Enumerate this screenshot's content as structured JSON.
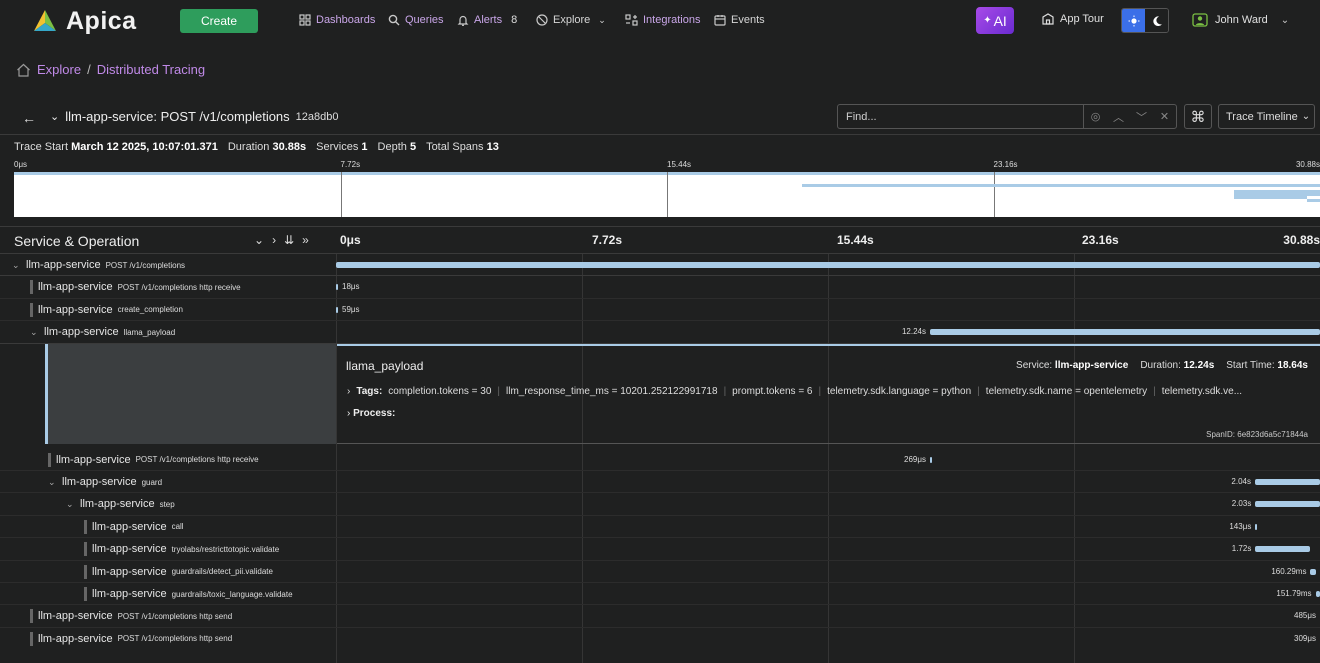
{
  "nav": {
    "brand": "Apica",
    "create": "Create",
    "items": [
      "Dashboards",
      "Queries",
      "Alerts",
      "Explore",
      "Integrations",
      "Events"
    ],
    "alerts_count": "8",
    "ai": "AI",
    "app_tour": "App Tour",
    "user": "John Ward"
  },
  "breadcrumb": {
    "items": [
      "Explore",
      "Distributed Tracing"
    ],
    "sep": "/"
  },
  "trace": {
    "title": "llm-app-service: POST /v1/completions",
    "id": "12a8db0",
    "find_placeholder": "Find...",
    "view": "Trace Timeline",
    "meta": {
      "start_label": "Trace Start",
      "start": "March 12 2025, 10:07:01.371",
      "duration_label": "Duration",
      "duration": "30.88s",
      "services_label": "Services",
      "services": "1",
      "depth_label": "Depth",
      "depth": "5",
      "spans_label": "Total Spans",
      "spans": "13"
    }
  },
  "timeline": {
    "ticks": [
      "0μs",
      "7.72s",
      "15.44s",
      "23.16s",
      "30.88s"
    ],
    "header_label": "Service & Operation"
  },
  "spans": [
    {
      "service": "llm-app-service",
      "op": "POST /v1/completions",
      "depth": 0,
      "toggle": true,
      "start": 0,
      "dur": 30.88,
      "dur_label": ""
    },
    {
      "service": "llm-app-service",
      "op": "POST /v1/completions http receive",
      "depth": 1,
      "toggle": false,
      "start": 0,
      "dur": 1.8e-05,
      "dur_label": "18μs"
    },
    {
      "service": "llm-app-service",
      "op": "create_completion",
      "depth": 1,
      "toggle": false,
      "start": 0,
      "dur": 5.9e-05,
      "dur_label": "59μs"
    },
    {
      "service": "llm-app-service",
      "op": "llama_payload",
      "depth": 1,
      "toggle": true,
      "start": 18.64,
      "dur": 12.24,
      "dur_label": "12.24s"
    },
    {
      "service": "llm-app-service",
      "op": "POST /v1/completions http receive",
      "depth": 2,
      "toggle": false,
      "start": 18.64,
      "dur": 0.000269,
      "dur_label": "269μs"
    },
    {
      "service": "llm-app-service",
      "op": "guard",
      "depth": 2,
      "toggle": true,
      "start": 28.84,
      "dur": 2.04,
      "dur_label": "2.04s"
    },
    {
      "service": "llm-app-service",
      "op": "step",
      "depth": 3,
      "toggle": true,
      "start": 28.85,
      "dur": 2.03,
      "dur_label": "2.03s"
    },
    {
      "service": "llm-app-service",
      "op": "call",
      "depth": 4,
      "toggle": false,
      "start": 28.85,
      "dur": 0.000143,
      "dur_label": "143μs"
    },
    {
      "service": "llm-app-service",
      "op": "tryolabs/restricttotopic.validate",
      "depth": 4,
      "toggle": false,
      "start": 28.85,
      "dur": 1.72,
      "dur_label": "1.72s"
    },
    {
      "service": "llm-app-service",
      "op": "guardrails/detect_pii.validate",
      "depth": 4,
      "toggle": false,
      "start": 30.58,
      "dur": 0.16029,
      "dur_label": "160.29ms"
    },
    {
      "service": "llm-app-service",
      "op": "guardrails/toxic_language.validate",
      "depth": 4,
      "toggle": false,
      "start": 30.74,
      "dur": 0.15179,
      "dur_label": "151.79ms"
    },
    {
      "service": "llm-app-service",
      "op": "POST /v1/completions http send",
      "depth": 1,
      "toggle": false,
      "start": 30.879,
      "dur": 0.000485,
      "dur_label": "485μs"
    },
    {
      "service": "llm-app-service",
      "op": "POST /v1/completions http send",
      "depth": 1,
      "toggle": false,
      "start": 30.8795,
      "dur": 0.000309,
      "dur_label": "309μs"
    }
  ],
  "detail": {
    "name": "llama_payload",
    "service_label": "Service:",
    "service": "llm-app-service",
    "duration_label": "Duration:",
    "duration": "12.24s",
    "start_label": "Start Time:",
    "start": "18.64s",
    "tags_label": "Tags:",
    "tags": [
      "completion.tokens = 30",
      "llm_response_time_ms = 10201.252122991718",
      "prompt.tokens = 6",
      "telemetry.sdk.language = python",
      "telemetry.sdk.name = opentelemetry",
      "telemetry.sdk.ve..."
    ],
    "process_label": "Process:",
    "span_id": "SpanID: 6e823d6a5c71844a"
  },
  "colors": {
    "accent": "#c08ae8",
    "bar": "#a9cbe6",
    "create": "#2e9d5c",
    "ai": "#8e3ee0"
  }
}
